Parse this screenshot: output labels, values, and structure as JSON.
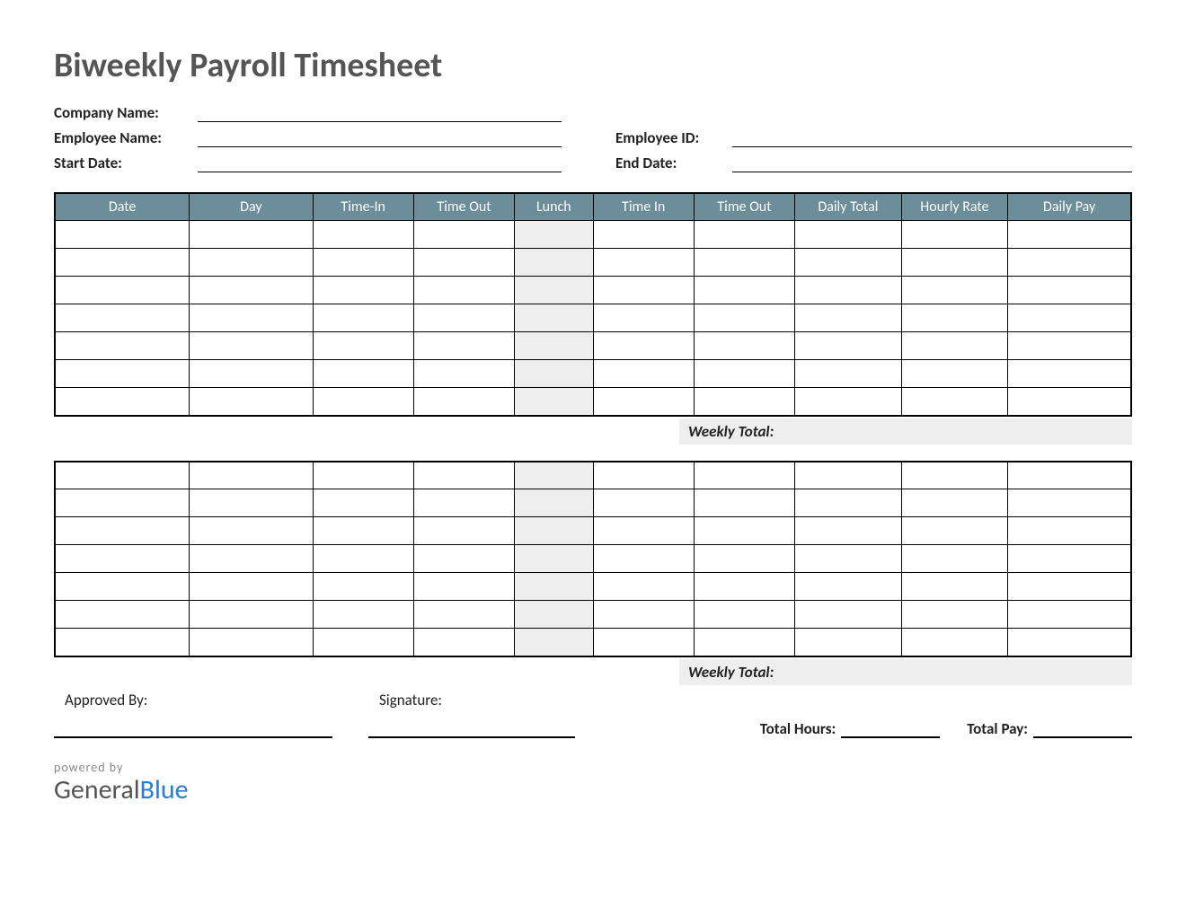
{
  "title": "Biweekly Payroll Timesheet",
  "info": {
    "company_label": "Company Name:",
    "employee_label": "Employee Name:",
    "employee_id_label": "Employee ID:",
    "start_date_label": "Start Date:",
    "end_date_label": "End Date:"
  },
  "columns": {
    "date": "Date",
    "day": "Day",
    "time_in_1": "Time-In",
    "time_out_1": "Time Out",
    "lunch": "Lunch",
    "time_in_2": "Time In",
    "time_out_2": "Time Out",
    "daily_total": "Daily Total",
    "hourly_rate": "Hourly Rate",
    "daily_pay": "Daily Pay"
  },
  "weekly_total_label": "Weekly Total:",
  "footer": {
    "approved_label": "Approved By:",
    "signature_label": "Signature:",
    "total_hours_label": "Total Hours:",
    "total_pay_label": "Total Pay:"
  },
  "brand": {
    "powered": "powered by",
    "name1": "General",
    "name2": "Blue"
  },
  "week1_rows": 7,
  "week2_rows": 7
}
